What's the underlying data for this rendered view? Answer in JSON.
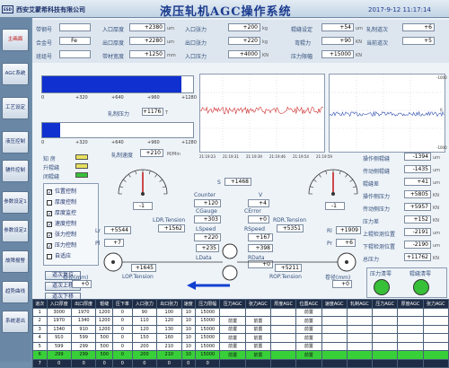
{
  "header": {
    "logo": "ESD",
    "company": "西安艾蒙希科技有限公司",
    "title": "液压轧机AGC操作系统",
    "datetime": "2017-9-12  11:17:14"
  },
  "nav": {
    "items": [
      {
        "label": "主画面",
        "active": true
      },
      {
        "label": "AGC系统",
        "active": false
      },
      {
        "label": "工艺设定",
        "active": false
      },
      {
        "label": "液压控制",
        "active": false
      },
      {
        "label": "辅件控制",
        "active": false
      },
      {
        "label": "参数设定1",
        "active": false
      },
      {
        "label": "参数设定2",
        "active": false
      },
      {
        "label": "故障报警",
        "active": false
      },
      {
        "label": "趋势曲线",
        "active": false
      },
      {
        "label": "系统退出",
        "active": false
      }
    ]
  },
  "params": {
    "r1": [
      {
        "label": "带钢号",
        "value": "",
        "unit": ""
      },
      {
        "label": "入口厚度",
        "value": "+2380",
        "unit": "um"
      },
      {
        "label": "入口张力",
        "value": "+200",
        "unit": "kg"
      },
      {
        "label": "辊缝设定",
        "value": "+54",
        "unit": "um"
      },
      {
        "label": "轧制道次",
        "value": "+6",
        "unit": ""
      }
    ],
    "r2": [
      {
        "label": "合金号",
        "value": "Fe",
        "unit": ""
      },
      {
        "label": "出口厚度",
        "value": "+2280",
        "unit": "um"
      },
      {
        "label": "出口张力",
        "value": "+220",
        "unit": "kg"
      },
      {
        "label": "弯辊力",
        "value": "+90",
        "unit": "KN"
      },
      {
        "label": "当前道次",
        "value": "+5",
        "unit": ""
      }
    ],
    "r3": [
      {
        "label": "班组号",
        "value": "",
        "unit": ""
      },
      {
        "label": "带材宽度",
        "value": "+1250",
        "unit": "mm"
      },
      {
        "label": "入口压力",
        "value": "+4000",
        "unit": "KN"
      },
      {
        "label": "压力限幅",
        "value": "+15000",
        "unit": "KN"
      }
    ]
  },
  "bars": {
    "top_scale": [
      "0",
      "+320",
      "+640",
      "+960",
      "+1280"
    ],
    "rolling_force_label": "轧制压力",
    "rolling_force_value": "+1176",
    "rolling_force_unit": "T",
    "rolling_force_fill": 0.92,
    "bottom_fill": 0.12,
    "bottom_scale": [
      "0",
      "+320",
      "+640",
      "+960",
      "+1280"
    ]
  },
  "trend": {
    "times": [
      "21:19:23",
      "21:19:31",
      "21:19:39",
      "21:19:46",
      "21:19:54",
      "21:19:59"
    ],
    "yr": [
      "-1000",
      "0",
      "-1000"
    ]
  },
  "leds": {
    "title": "知  房",
    "items": [
      {
        "label": "知  房",
        "color": "#e8e060"
      },
      {
        "label": "升辊缝",
        "color": "#e8e060"
      },
      {
        "label": "闭辊缝",
        "color": "#38c038"
      }
    ]
  },
  "checks": [
    {
      "label": "位置控制",
      "checked": true
    },
    {
      "label": "厚度控制",
      "checked": false
    },
    {
      "label": "厚度监控",
      "checked": true
    },
    {
      "label": "速度控制",
      "checked": true
    },
    {
      "label": "张力控制",
      "checked": true
    },
    {
      "label": "压力控制",
      "checked": true
    },
    {
      "label": "自适应",
      "checked": false
    }
  ],
  "buttons": {
    "reset": "道次复位",
    "up": "道次上移",
    "down": "道次下移"
  },
  "gauges": {
    "speed_label": "轧制速度",
    "speed_value": "+210",
    "speed_unit": "M/Min",
    "left_value": "-1",
    "right_value": "-1",
    "s_label": "S",
    "s_value": "+1468",
    "scale": [
      "-5",
      "-4",
      "-3",
      "-2",
      "-1",
      "0",
      "1",
      "2",
      "3",
      "4",
      "5"
    ]
  },
  "mill": {
    "counter": "Counter",
    "counter_val": "+120",
    "v": "V",
    "v_val": "+4",
    "cgauge": "CGauge",
    "cgauge_val": "+303",
    "cerror": "CError",
    "cerror_val": "+0",
    "ldr": "LDR.Tension",
    "ldr_val": "+1562",
    "rdr": "RDR.Tension",
    "rdr_val": "+5351",
    "lspeed": "LSpeed",
    "lspeed_val": "+220",
    "rspeed": "RSpeed",
    "rspeed_val": "+167",
    "ldata": "LData",
    "ldata_val": "+235",
    "rdata": "RData",
    "rdata_val": "+398",
    "rdata2_val": "+0",
    "l1": "Lr",
    "l1_val": "+5544",
    "pl": "Pl",
    "pl_val": "+7",
    "r1": "Rl",
    "r1_val": "+1909",
    "pr": "Pr",
    "pr_val": "+6",
    "lop": "LOP.Tension",
    "lop_val": "+1645",
    "rop": "ROP.Tension",
    "rop_val": "+5211",
    "left_count_label": "卷径(mm)",
    "left_count": "+0",
    "right_count_label": "卷径(mm)",
    "right_count": "+0"
  },
  "right_params": [
    {
      "label": "操作侧辊缝",
      "value": "-1394",
      "unit": "um"
    },
    {
      "label": "传动侧辊缝",
      "value": "-1435",
      "unit": "um"
    },
    {
      "label": "辊缝差",
      "value": "+41",
      "unit": "um"
    },
    {
      "label": "操作侧压力",
      "value": "+5805",
      "unit": "KN"
    },
    {
      "label": "传动侧压力",
      "value": "+5957",
      "unit": "KN"
    },
    {
      "label": "压力差",
      "value": "+152",
      "unit": "KN"
    },
    {
      "label": "上辊检测位置",
      "value": "-2191",
      "unit": "um"
    },
    {
      "label": "下辊检测位置",
      "value": "-2190",
      "unit": "um"
    },
    {
      "label": "总压力",
      "value": "+11762",
      "unit": "KN"
    }
  ],
  "circles": {
    "left_label": "压力清零",
    "right_label": "辊缝清零",
    "color": "#38c038"
  },
  "table": {
    "headers": [
      "道次",
      "入口厚度",
      "出口厚度",
      "辊缝",
      "压下率",
      "入口张力",
      "出口张力",
      "速度",
      "压力限幅",
      "压力AGC",
      "张力AGC",
      "厚度AGC",
      "位置AGC",
      "速度AGC",
      "轧制AGC",
      "压力AGC",
      "厚度AGC",
      "张力AGC"
    ],
    "rows": [
      {
        "cells": [
          "1",
          "3000",
          "1970",
          "1200",
          "0",
          "90",
          "100",
          "10",
          "15000",
          "",
          "",
          "",
          "前置",
          "",
          "",
          "",
          "",
          ""
        ],
        "style": ""
      },
      {
        "cells": [
          "2",
          "1970",
          "1340",
          "1200",
          "0",
          "110",
          "120",
          "10",
          "15000",
          "前置",
          "前置",
          "",
          "前置",
          "",
          "",
          "",
          "",
          ""
        ],
        "style": ""
      },
      {
        "cells": [
          "3",
          "1340",
          "910",
          "1200",
          "0",
          "120",
          "130",
          "10",
          "15000",
          "前置",
          "前置",
          "",
          "前置",
          "",
          "",
          "",
          "",
          ""
        ],
        "style": ""
      },
      {
        "cells": [
          "4",
          "910",
          "599",
          "500",
          "0",
          "150",
          "160",
          "10",
          "15000",
          "前置",
          "前置",
          "",
          "前置",
          "",
          "",
          "",
          "",
          ""
        ],
        "style": ""
      },
      {
        "cells": [
          "5",
          "599",
          "299",
          "500",
          "0",
          "200",
          "210",
          "10",
          "15000",
          "前置",
          "前置",
          "",
          "前置",
          "",
          "",
          "",
          "",
          ""
        ],
        "style": ""
      },
      {
        "cells": [
          "6",
          "299",
          "299",
          "500",
          "0",
          "200",
          "210",
          "10",
          "15000",
          "前置",
          "前置",
          "",
          "前置",
          "",
          "",
          "",
          "",
          ""
        ],
        "style": "hl"
      },
      {
        "cells": [
          "7",
          "0",
          "0",
          "0",
          "0",
          "0",
          "0",
          "0",
          "0",
          "",
          "",
          "",
          "",
          "",
          "",
          "",
          "",
          ""
        ],
        "style": "dark"
      }
    ]
  },
  "colors": {
    "bar_fill": "#1030d0",
    "trend_line": "#d03030",
    "trend_line2": "#3050b0",
    "needle": "#c01010",
    "arrow": "#1040d0"
  }
}
